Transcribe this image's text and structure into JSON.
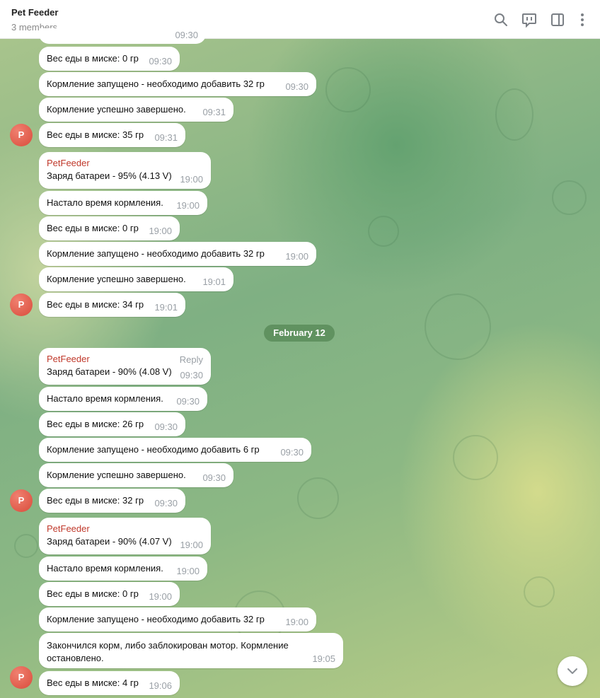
{
  "header": {
    "title": "Pet Feeder",
    "subtitle": "3 members",
    "icons": [
      "search-icon",
      "comments-icon",
      "sidebar-toggle-icon",
      "more-vertical-icon"
    ]
  },
  "date_separator": "February 12",
  "avatar_letter": "P",
  "sender_name": "PetFeeder",
  "reply_label": "Reply",
  "partial_time": "09:30",
  "messages": [
    {
      "text": "Вес еды в миске: 0 гр",
      "time": "09:30"
    },
    {
      "text": "Кормление запущено - необходимо добавить 32 гр",
      "time": "09:30"
    },
    {
      "text": "Кормление успешно завершено.",
      "time": "09:31"
    },
    {
      "text": "Вес еды в миске: 35 гр",
      "time": "09:31"
    },
    {
      "text": "Заряд батареи - 95% (4.13 V)",
      "time": "19:00"
    },
    {
      "text": "Настало время кормления.",
      "time": "19:00"
    },
    {
      "text": "Вес еды в миске: 0 гр",
      "time": "19:00"
    },
    {
      "text": "Кормление запущено - необходимо добавить 32 гр",
      "time": "19:00"
    },
    {
      "text": "Кормление успешно завершено.",
      "time": "19:01"
    },
    {
      "text": "Вес еды в миске: 34 гр",
      "time": "19:01"
    },
    {
      "text": "Заряд батареи - 90% (4.08 V)",
      "time": "09:30"
    },
    {
      "text": "Настало время кормления.",
      "time": "09:30"
    },
    {
      "text": "Вес еды в миске: 26 гр",
      "time": "09:30"
    },
    {
      "text": "Кормление запущено - необходимо добавить 6 гр",
      "time": "09:30"
    },
    {
      "text": "Кормление успешно завершено.",
      "time": "09:30"
    },
    {
      "text": "Вес еды в миске: 32 гр",
      "time": "09:30"
    },
    {
      "text": "Заряд батареи - 90% (4.07 V)",
      "time": "19:00"
    },
    {
      "text": "Настало время кормления.",
      "time": "19:00"
    },
    {
      "text": "Вес еды в миске: 0 гр",
      "time": "19:00"
    },
    {
      "text": "Кормление запущено - необходимо добавить 32 гр",
      "time": "19:00"
    },
    {
      "text": "Закончился корм, либо заблокирован мотор. Кормление остановлено.",
      "time": "19:05"
    },
    {
      "text": "Вес еды в миске: 4 гр",
      "time": "19:06"
    }
  ],
  "colors": {
    "sender": "#c0392b",
    "avatar": "#e05a48",
    "date_pill": "#5a8c5a",
    "time": "#9aa0a6"
  }
}
